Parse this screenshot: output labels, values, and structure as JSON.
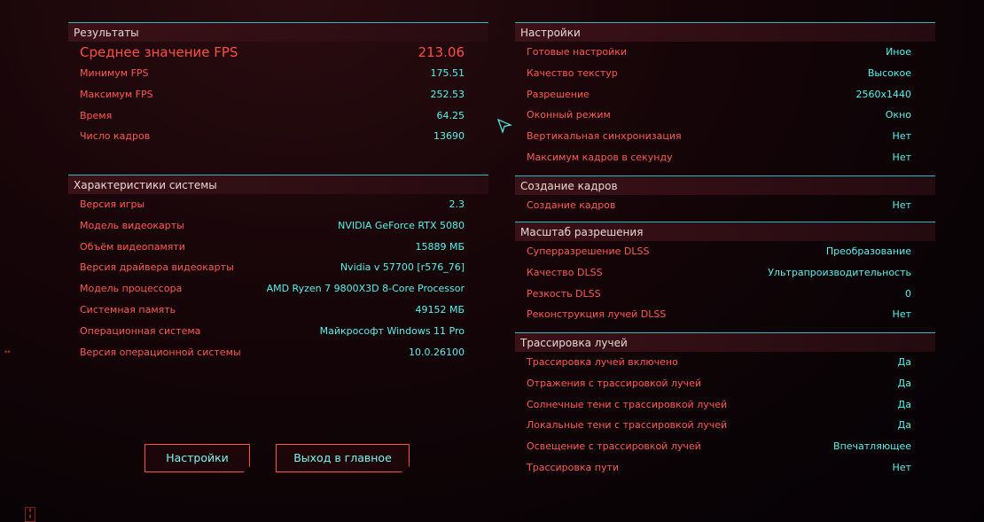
{
  "results": {
    "title": "Результаты",
    "avg_label": "Среднее значение FPS",
    "avg_value": "213.06",
    "rows": [
      {
        "label": "Минимум FPS",
        "value": "175.51"
      },
      {
        "label": "Максимум FPS",
        "value": "252.53"
      },
      {
        "label": "Время",
        "value": "64.25"
      },
      {
        "label": "Число кадров",
        "value": "13690"
      }
    ]
  },
  "system": {
    "title": "Характеристики системы",
    "rows": [
      {
        "label": "Версия игры",
        "value": "2.3"
      },
      {
        "label": "Модель видеокарты",
        "value": "NVIDIA GeForce RTX 5080"
      },
      {
        "label": "Объём видеопамяти",
        "value": "15889 МБ"
      },
      {
        "label": "Версия драйвера видеокарты",
        "value": "Nvidia v 57700 [r576_76]"
      },
      {
        "label": "Модель процессора",
        "value": "AMD Ryzen 7 9800X3D 8-Core Processor"
      },
      {
        "label": "Системная память",
        "value": "49152 МБ"
      },
      {
        "label": "Операционная система",
        "value": "Майкрософт Windows 11 Pro"
      },
      {
        "label": "Версия операционной системы",
        "value": "10.0.26100"
      }
    ]
  },
  "buttons": {
    "settings": "Настройки",
    "exit": "Выход в главное меню"
  },
  "settings": {
    "title": "Настройки",
    "rows": [
      {
        "label": "Готовые настройки",
        "value": "Иное"
      },
      {
        "label": "Качество текстур",
        "value": "Высокое"
      },
      {
        "label": "Разрешение",
        "value": "2560x1440"
      },
      {
        "label": "Оконный режим",
        "value": "Окно"
      },
      {
        "label": "Вертикальная синхронизация",
        "value": "Нет"
      },
      {
        "label": "Максимум кадров в секунду",
        "value": "Нет"
      }
    ]
  },
  "frames": {
    "title": "Создание кадров",
    "rows": [
      {
        "label": "Создание кадров",
        "value": "Нет"
      }
    ]
  },
  "scaling": {
    "title": "Масштаб разрешения",
    "rows": [
      {
        "label": "Суперразрешение DLSS",
        "value": "Преобразование"
      },
      {
        "label": "Качество DLSS",
        "value": "Ультрапроизводительность"
      },
      {
        "label": "Резкость DLSS",
        "value": "0"
      },
      {
        "label": "Реконструкция лучей DLSS",
        "value": "Нет"
      }
    ]
  },
  "raytracing": {
    "title": "Трассировка лучей",
    "rows": [
      {
        "label": "Трассировка лучей включено",
        "value": "Да"
      },
      {
        "label": "Отражения с трассировкой лучей",
        "value": "Да"
      },
      {
        "label": "Солнечные тени с трассировкой лучей",
        "value": "Да"
      },
      {
        "label": "Локальные тени с трассировкой лучей",
        "value": "Да"
      },
      {
        "label": "Освещение с трассировкой лучей",
        "value": "Впечатляющее"
      },
      {
        "label": "Трассировка пути",
        "value": "Нет"
      }
    ]
  },
  "colors": {
    "accent_red": "#ff5a52",
    "accent_cyan": "#5ef0ea",
    "border_cyan": "#2fb8c0"
  },
  "icons": {
    "cursor": "pointer-arrow-icon"
  }
}
